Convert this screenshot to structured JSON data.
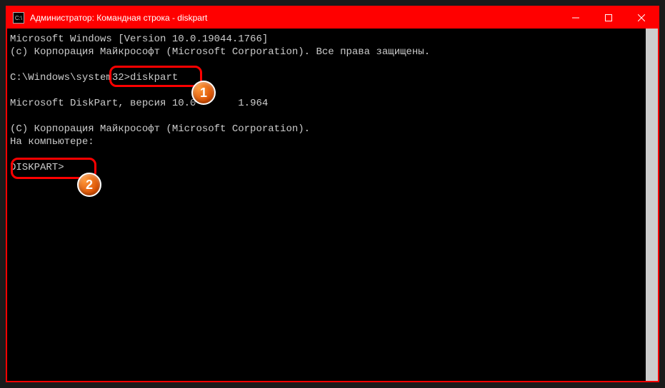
{
  "window": {
    "title": "Администратор: Командная строка - diskpart"
  },
  "terminal": {
    "line1": "Microsoft Windows [Version 10.0.19044.1766]",
    "line2": "(c) Корпорация Майкрософт (Microsoft Corporation). Все права защищены.",
    "blank1": "",
    "prompt1_prefix": "C:\\Windows\\system32>",
    "prompt1_typed": "diskpart",
    "blank2": "",
    "line3a": "Microsoft DiskPart, версия 10.0",
    "line3b": "1.964",
    "blank3": "",
    "line4": "(C) Корпорация Майкрософт (Microsoft Corporation).",
    "line5": "На компьютере:",
    "blank4": "",
    "prompt2": "DISKPART>"
  },
  "annotations": {
    "badge1": "1",
    "badge2": "2"
  }
}
